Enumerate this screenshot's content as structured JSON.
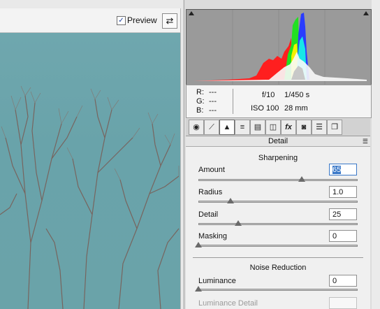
{
  "preview": {
    "checkbox_checked": true,
    "checkbox_mark": "✓",
    "label": "Preview",
    "compare_icon": "before-after-toggle-icon"
  },
  "readout": {
    "r_label": "R:",
    "r_value": "---",
    "g_label": "G:",
    "g_value": "---",
    "b_label": "B:",
    "b_value": "---",
    "aperture": "f/10",
    "shutter": "1/450 s",
    "iso": "ISO 100",
    "focal": "28 mm"
  },
  "tabs": [
    {
      "name": "basic",
      "glyph": "◉"
    },
    {
      "name": "tone-curve",
      "glyph": "⟋"
    },
    {
      "name": "detail",
      "glyph": "▲",
      "active": true
    },
    {
      "name": "hsl",
      "glyph": "≡"
    },
    {
      "name": "split-toning",
      "glyph": "▤"
    },
    {
      "name": "lens-corrections",
      "glyph": "◫"
    },
    {
      "name": "effects",
      "glyph": "fx"
    },
    {
      "name": "camera-calibration",
      "glyph": "◙"
    },
    {
      "name": "presets",
      "glyph": "☰"
    },
    {
      "name": "snapshots",
      "glyph": "❐"
    }
  ],
  "panel": {
    "title": "Detail",
    "sharpening": {
      "title": "Sharpening",
      "amount_label": "Amount",
      "amount_value": "65",
      "amount_level": 0.65,
      "radius_label": "Radius",
      "radius_value": "1.0",
      "radius_level": 0.2,
      "detail_label": "Detail",
      "detail_value": "25",
      "detail_level": 0.25,
      "masking_label": "Masking",
      "masking_value": "0",
      "masking_level": 0.0
    },
    "noise": {
      "title": "Noise Reduction",
      "luminance_label": "Luminance",
      "luminance_value": "0",
      "luminance_level": 0.0,
      "luminance_detail_label": "Luminance Detail"
    }
  },
  "colors": {
    "sky": "#6aa4ab",
    "histogram_bg": "#9a9a9a",
    "red": "#ff1f1f",
    "green": "#22e022",
    "blue": "#2a3cff",
    "yellow": "#f4f000",
    "focus": "#3a78c8"
  }
}
